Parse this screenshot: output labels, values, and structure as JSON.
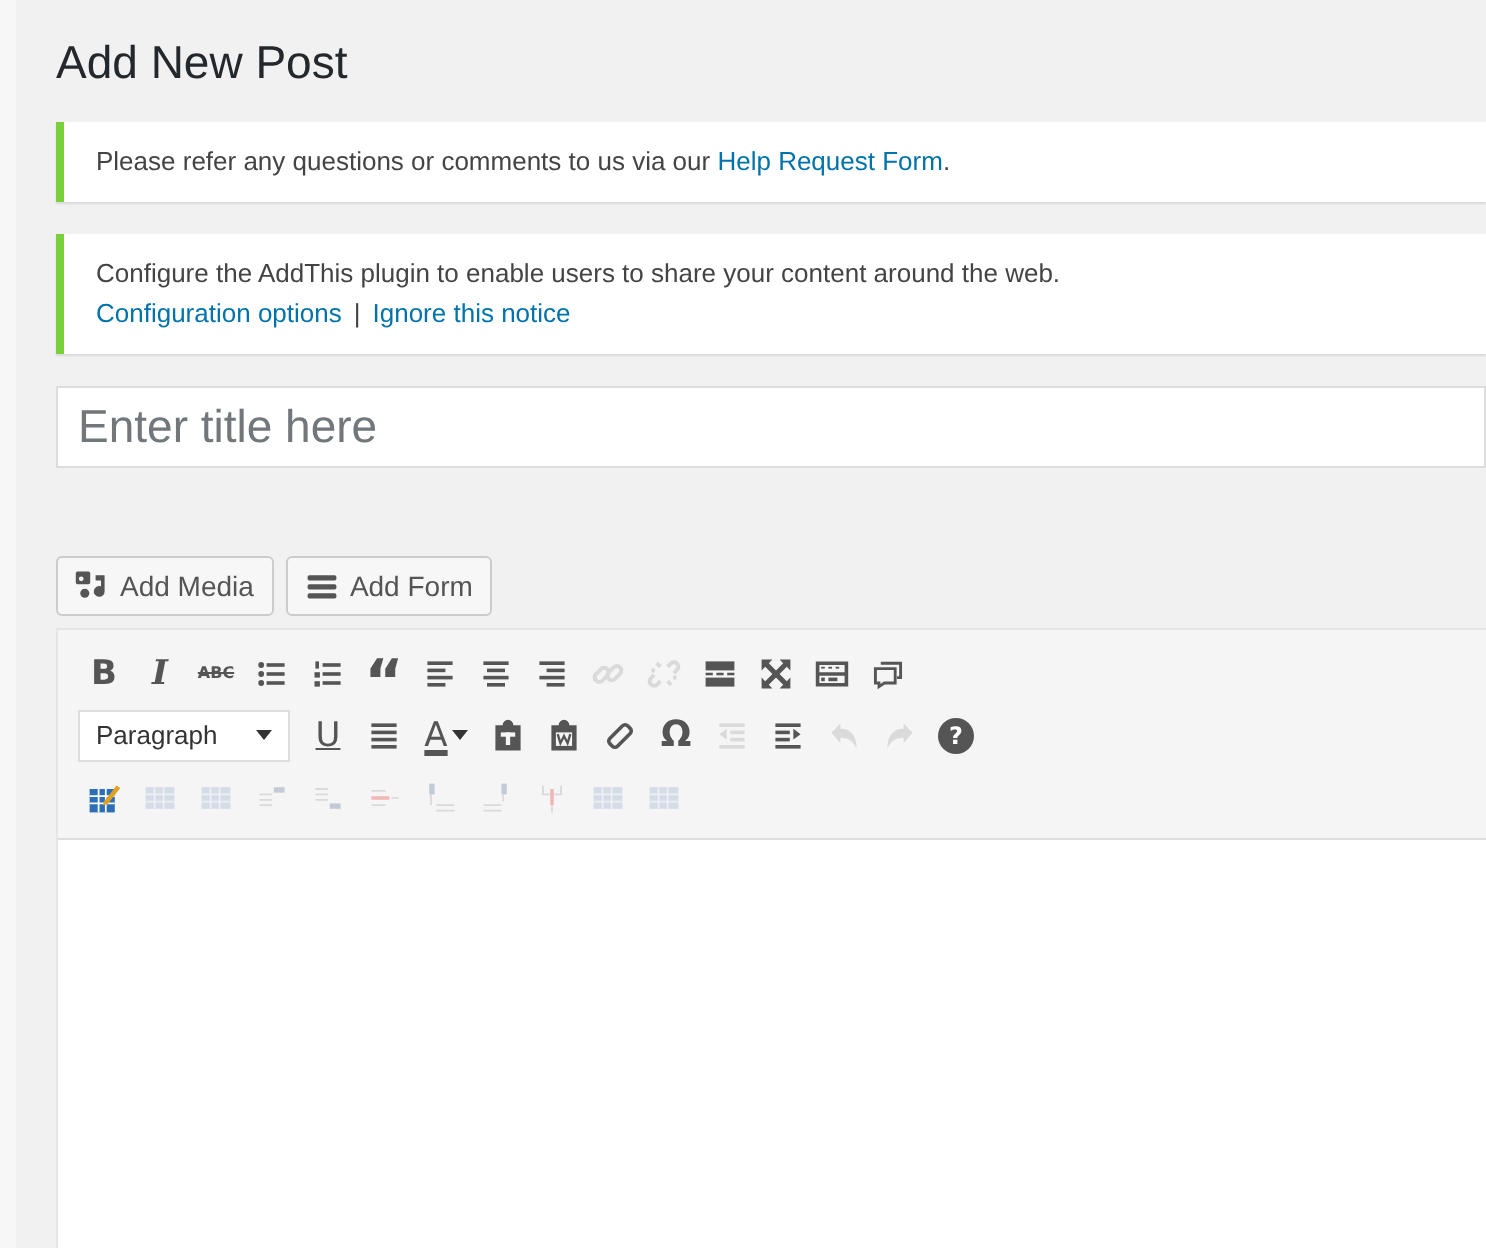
{
  "heading": "Add New Post",
  "notices": [
    {
      "parts": [
        {
          "kind": "text",
          "text": "Please refer any questions or comments to us via our "
        },
        {
          "kind": "link",
          "text": "Help Request Form"
        },
        {
          "kind": "text",
          "text": "."
        }
      ]
    },
    {
      "parts": [
        {
          "kind": "text",
          "text": "Configure the AddThis plugin to enable users to share your content around the web."
        }
      ],
      "links": [
        "Configuration options",
        "Ignore this notice"
      ],
      "link_separator": "|"
    }
  ],
  "title_field": {
    "placeholder": "Enter title here"
  },
  "media_buttons": [
    {
      "kind": "media",
      "label": "Add Media"
    },
    {
      "kind": "form",
      "label": "Add Form"
    }
  ],
  "toolbar": {
    "format_select": {
      "value": "Paragraph"
    },
    "rows": [
      [
        {
          "kind": "bold",
          "label": "B",
          "disabled": false
        },
        {
          "kind": "italic",
          "label": "I",
          "disabled": false
        },
        {
          "kind": "strike",
          "label": "ABC",
          "disabled": false
        },
        {
          "kind": "bullet-list",
          "disabled": false
        },
        {
          "kind": "numbered-list",
          "disabled": false
        },
        {
          "kind": "quote",
          "label": "“",
          "disabled": false
        },
        {
          "kind": "align-left",
          "disabled": false
        },
        {
          "kind": "align-center",
          "disabled": false
        },
        {
          "kind": "align-right",
          "disabled": false
        },
        {
          "kind": "link",
          "disabled": true
        },
        {
          "kind": "unlink",
          "disabled": true
        },
        {
          "kind": "more",
          "disabled": false
        },
        {
          "kind": "fullscreen",
          "disabled": false
        },
        {
          "kind": "keyboard",
          "disabled": false
        },
        {
          "kind": "comment",
          "disabled": false
        }
      ],
      [
        {
          "kind": "select"
        },
        {
          "kind": "underline",
          "label": "U",
          "disabled": false
        },
        {
          "kind": "justify",
          "disabled": false
        },
        {
          "kind": "text-color",
          "label": "A",
          "disabled": false
        },
        {
          "kind": "paste-text",
          "disabled": false
        },
        {
          "kind": "paste-word",
          "disabled": false
        },
        {
          "kind": "eraser",
          "disabled": false
        },
        {
          "kind": "omega",
          "label": "Ω",
          "disabled": false
        },
        {
          "kind": "outdent",
          "disabled": true
        },
        {
          "kind": "indent",
          "disabled": false
        },
        {
          "kind": "undo",
          "disabled": true
        },
        {
          "kind": "redo",
          "disabled": true
        },
        {
          "kind": "help",
          "label": "?",
          "disabled": false
        }
      ],
      [
        {
          "kind": "table-edit",
          "disabled": false
        },
        {
          "kind": "table",
          "disabled": true
        },
        {
          "kind": "table",
          "disabled": true
        },
        {
          "kind": "row-before",
          "disabled": true
        },
        {
          "kind": "row-after",
          "disabled": true
        },
        {
          "kind": "row-delete",
          "disabled": true
        },
        {
          "kind": "col-before",
          "disabled": true
        },
        {
          "kind": "col-after",
          "disabled": true
        },
        {
          "kind": "col-delete",
          "disabled": true
        },
        {
          "kind": "table",
          "disabled": true
        },
        {
          "kind": "table",
          "disabled": true
        }
      ]
    ]
  }
}
